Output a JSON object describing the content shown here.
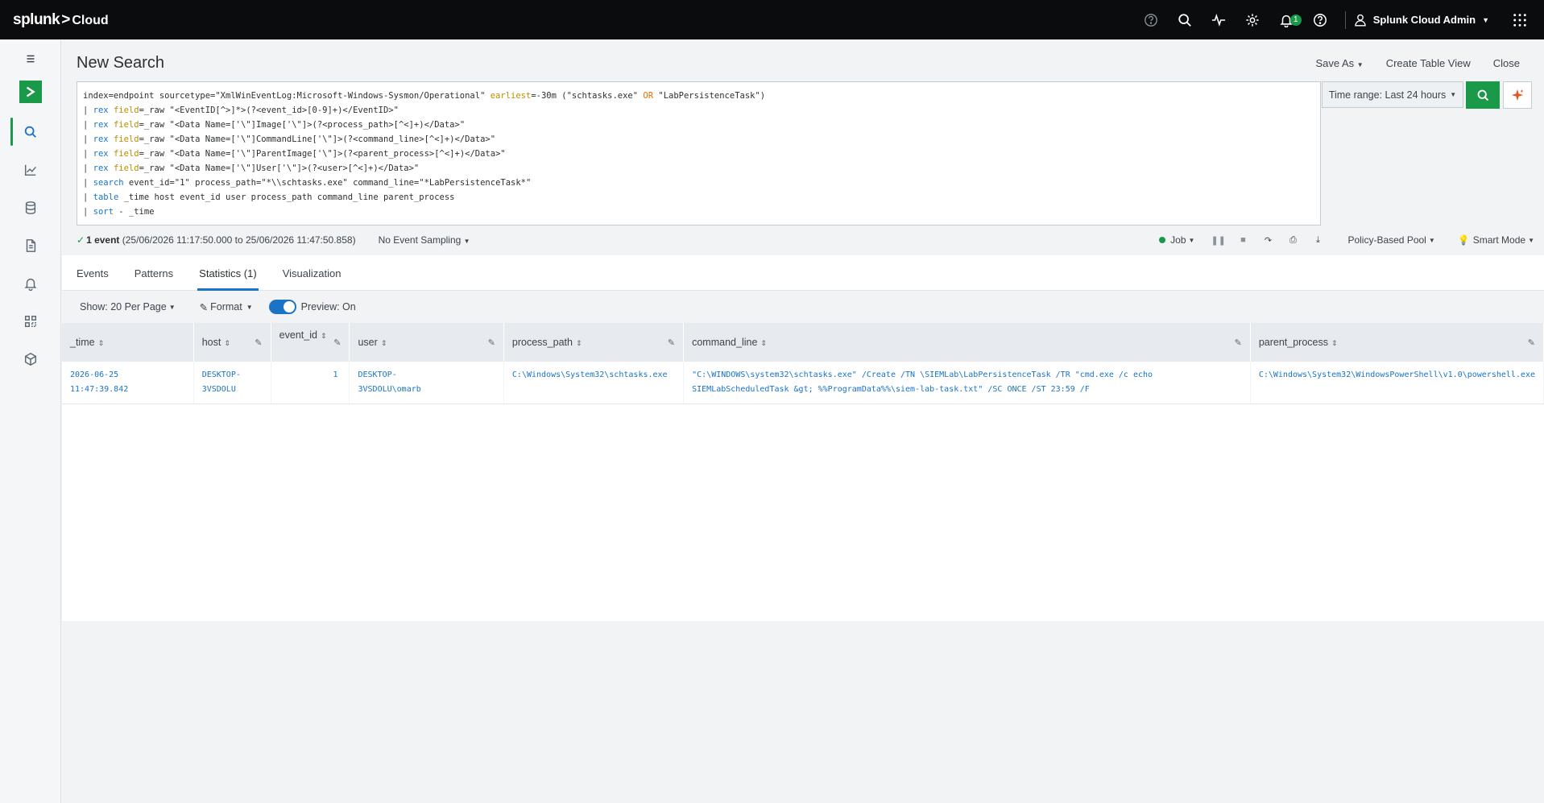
{
  "topbar": {
    "logo_splunk": "splunk",
    "logo_gt": ">",
    "logo_cloud": "Cloud",
    "notification_count": "1",
    "user_name": "Splunk Cloud Admin",
    "icons": [
      "help-circle-icon",
      "search-icon",
      "activity-icon",
      "gear-icon",
      "bell-icon",
      "question-icon",
      "user-icon",
      "apps-grid-icon"
    ]
  },
  "sidebar": {
    "items": [
      "menu-icon",
      "app-logo",
      "search-icon",
      "chart-icon",
      "database-icon",
      "report-icon",
      "alert-icon",
      "dashboard-icon",
      "cube-icon"
    ]
  },
  "page": {
    "title": "New Search",
    "actions": {
      "save_as": "Save As",
      "create_table_view": "Create Table View",
      "close": "Close"
    }
  },
  "search": {
    "time_range": "Time range: Last 24 hours"
  },
  "job": {
    "event_count": "1 event",
    "range": "(25/06/2026 11:17:50.000 to 25/06/2026 11:47:50.858)",
    "sampling": "No Event Sampling",
    "job_label": "Job",
    "pool": "Policy-Based Pool",
    "mode": "Smart Mode"
  },
  "tabs": [
    "Events",
    "Patterns",
    "Statistics (1)",
    "Visualization"
  ],
  "options": {
    "show": "Show: 20 Per Page",
    "format": "Format",
    "preview": "Preview: On"
  },
  "table": {
    "columns": [
      "_time",
      "host",
      "event_id",
      "user",
      "process_path",
      "command_line",
      "parent_process"
    ],
    "row": {
      "time_line1": "2026-06-25",
      "time_line2": "11:47:39.842",
      "host_line1": "DESKTOP-",
      "host_line2": "3VSDOLU",
      "event_id": "1",
      "user_line1": "DESKTOP-",
      "user_line2": "3VSDOLU\\omarb",
      "process_path": "C:\\Windows\\System32\\schtasks.exe",
      "command_line1": "\"C:\\WINDOWS\\system32\\schtasks.exe\" /Create /TN \\SIEMLab\\LabPersistenceTask /TR \"cmd.exe /c echo",
      "command_line2": "SIEMLabScheduledTask &gt; %%ProgramData%%\\siem-lab-task.txt\" /SC ONCE /ST 23:59 /F",
      "parent_process": "C:\\Windows\\System32\\WindowsPowerShell\\v1.0\\powershell.exe"
    }
  },
  "colors": {
    "accent_green": "#1a9a49",
    "link_blue": "#1a73c5",
    "topbar": "#0b0c0e"
  }
}
